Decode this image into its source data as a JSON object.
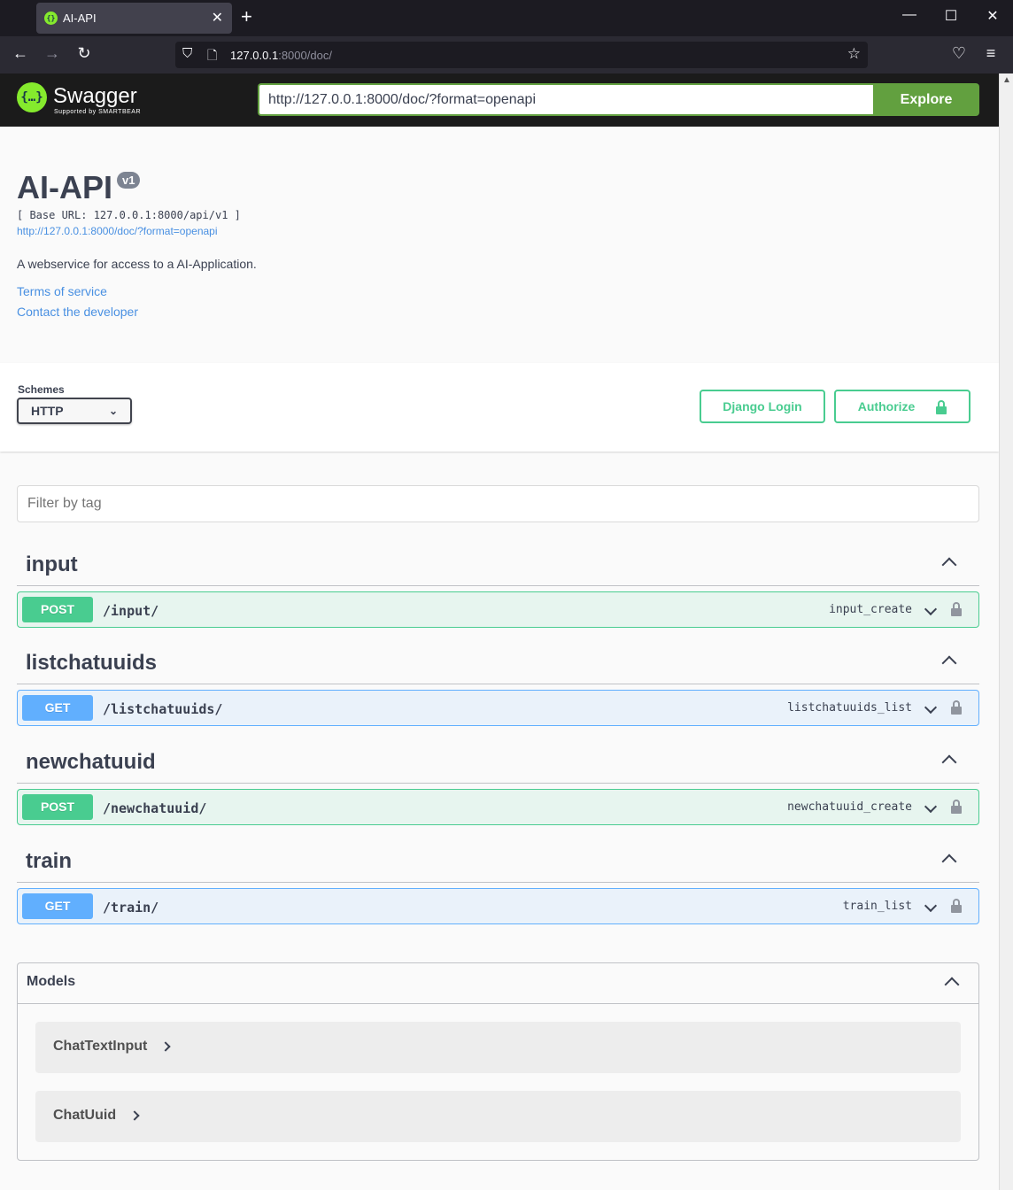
{
  "browser": {
    "tab_title": "AI-API",
    "url_host": "127.0.0.1",
    "url_rest": ":8000/doc/",
    "new_tab_label": "+"
  },
  "swagger": {
    "logo_text": "Swagger",
    "logo_subtext": "Supported by SMARTBEAR",
    "spec_url_input": "http://127.0.0.1:8000/doc/?format=openapi",
    "explore_label": "Explore"
  },
  "info": {
    "title": "AI-API",
    "version": "v1",
    "base_url": "[ Base URL: 127.0.0.1:8000/api/v1 ]",
    "spec_link": "http://127.0.0.1:8000/doc/?format=openapi",
    "description": "A webservice for access to a AI-Application.",
    "terms_link": "Terms of service",
    "contact_link": "Contact the developer"
  },
  "schemes": {
    "label": "Schemes",
    "selected": "HTTP",
    "django_login_label": "Django Login",
    "authorize_label": "Authorize"
  },
  "filter": {
    "placeholder": "Filter by tag"
  },
  "tags": [
    {
      "name": "input",
      "operation": {
        "method": "POST",
        "path": "/input/",
        "op_id": "input_create"
      }
    },
    {
      "name": "listchatuuids",
      "operation": {
        "method": "GET",
        "path": "/listchatuuids/",
        "op_id": "listchatuuids_list"
      }
    },
    {
      "name": "newchatuuid",
      "operation": {
        "method": "POST",
        "path": "/newchatuuid/",
        "op_id": "newchatuuid_create"
      }
    },
    {
      "name": "train",
      "operation": {
        "method": "GET",
        "path": "/train/",
        "op_id": "train_list"
      }
    }
  ],
  "models": {
    "title": "Models",
    "items": [
      "ChatTextInput",
      "ChatUuid"
    ]
  },
  "colors": {
    "post": "#49cc90",
    "get": "#61affe",
    "explore": "#62a03f",
    "link": "#4990e2"
  }
}
